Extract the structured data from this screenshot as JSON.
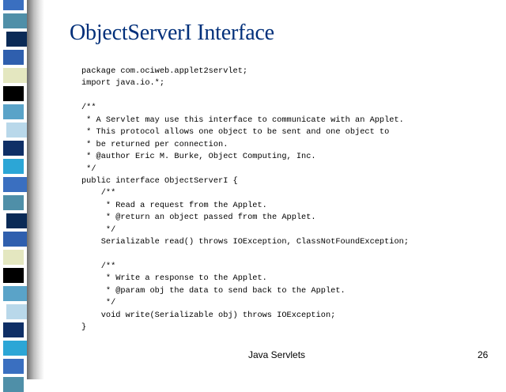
{
  "slide": {
    "title": "ObjectServerI Interface",
    "code_lines": [
      "package com.ociweb.applet2servlet;",
      "import java.io.*;",
      "",
      "/**",
      " * A Servlet may use this interface to communicate with an Applet.",
      " * This protocol allows one object to be sent and one object to",
      " * be returned per connection.",
      " * @author Eric M. Burke, Object Computing, Inc.",
      " */",
      "public interface ObjectServerI {",
      "    /**",
      "     * Read a request from the Applet.",
      "     * @return an object passed from the Applet.",
      "     */",
      "    Serializable read() throws IOException, ClassNotFoundException;",
      "",
      "    /**",
      "     * Write a response to the Applet.",
      "     * @param obj the data to send back to the Applet.",
      "     */",
      "    void write(Serializable obj) throws IOException;",
      "}"
    ],
    "footer_title": "Java Servlets",
    "page_number": "26"
  },
  "theme": {
    "title_color": "#002f7a",
    "stripe_colors": [
      "#3a6fc0",
      "#4f8fa8",
      "#0a2a56",
      "#2f5fae",
      "#e4e7c0",
      "#000000",
      "#5aa3c8",
      "#b9d8ea",
      "#0f2f66",
      "#2ca6d6"
    ]
  }
}
